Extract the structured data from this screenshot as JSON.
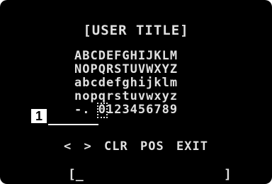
{
  "title": "[USER TITLE]",
  "charmap": {
    "rows": [
      "ABCDEFGHIJKLM",
      "NOPQRSTUVWXYZ",
      "abcdefghijklm",
      "nopqrstuvwxyz"
    ],
    "last_row_prefix": "-.",
    "last_row_selected": " ",
    "last_row_rest": "0123456789"
  },
  "callout": "1",
  "menu": {
    "left": "<",
    "right": ">",
    "clr": "CLR",
    "pos": "POS",
    "exit": "EXIT"
  },
  "input": {
    "value": "[_",
    "end": "]"
  },
  "colors": {
    "screen_bg": "#000000",
    "text": "#e0e0e0"
  }
}
